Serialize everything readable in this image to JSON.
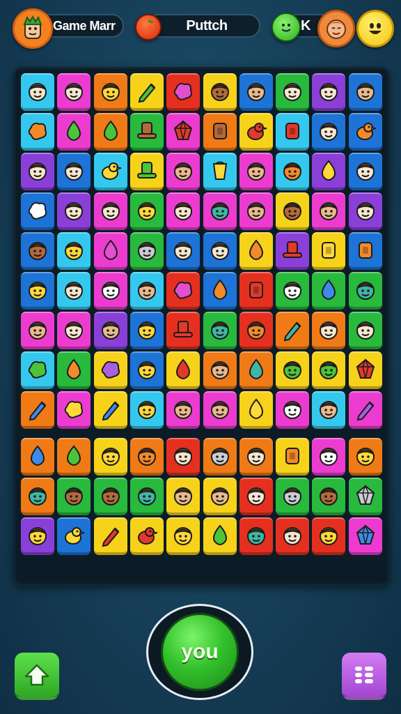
{
  "header": {
    "player_name": "Game Marr",
    "center_label": "Puttch",
    "right_label": "K"
  },
  "play_button_label": "you",
  "colors": {
    "background": "#163f58",
    "play_button": "#34c22c",
    "home_button": "#3fc334",
    "grid_button": "#b95de2"
  },
  "tile_palette": {
    "c": "#35c8ee",
    "m": "#ec3ccf",
    "o": "#f07a15",
    "y": "#f7d21a",
    "r": "#e5301f",
    "b": "#1d73d6",
    "g": "#28b93d",
    "p": "#8b3fd9"
  },
  "board": {
    "columns": 10,
    "rows": [
      [
        [
          "c",
          "face",
          "cream"
        ],
        [
          "m",
          "face",
          "cream"
        ],
        [
          "o",
          "face",
          "yellow"
        ],
        [
          "y",
          "pencil",
          "green"
        ],
        [
          "r",
          "blob",
          "magenta"
        ],
        [
          "y",
          "face",
          "brown"
        ],
        [
          "b",
          "face",
          "tan"
        ],
        [
          "g",
          "face",
          "cream"
        ],
        [
          "p",
          "face",
          "cream"
        ],
        [
          "b",
          "face",
          "tan"
        ]
      ],
      [
        [
          "c",
          "blob",
          "orange"
        ],
        [
          "m",
          "drop",
          "green"
        ],
        [
          "o",
          "drop",
          "green"
        ],
        [
          "g",
          "hat",
          "brown"
        ],
        [
          "m",
          "gem",
          "red"
        ],
        [
          "o",
          "box",
          "brown"
        ],
        [
          "y",
          "bird",
          "red"
        ],
        [
          "c",
          "box",
          "red"
        ],
        [
          "b",
          "face",
          "cream"
        ],
        [
          "b",
          "bird",
          "orange"
        ]
      ],
      [
        [
          "p",
          "face",
          "cream"
        ],
        [
          "b",
          "face",
          "cream"
        ],
        [
          "c",
          "bird",
          "yellow"
        ],
        [
          "y",
          "hat",
          "green"
        ],
        [
          "m",
          "face",
          "tan"
        ],
        [
          "c",
          "cup",
          "yellow"
        ],
        [
          "m",
          "face",
          "tan"
        ],
        [
          "c",
          "face",
          "orange"
        ],
        [
          "p",
          "drop",
          "yellow"
        ],
        [
          "b",
          "face",
          "cream"
        ]
      ],
      [
        [
          "b",
          "blob",
          "white"
        ],
        [
          "p",
          "face",
          "cream"
        ],
        [
          "m",
          "face",
          "cream"
        ],
        [
          "g",
          "face",
          "yellow"
        ],
        [
          "m",
          "face",
          "cream"
        ],
        [
          "m",
          "face",
          "teal"
        ],
        [
          "m",
          "face",
          "tan"
        ],
        [
          "y",
          "face",
          "brown"
        ],
        [
          "m",
          "face",
          "tan"
        ],
        [
          "p",
          "face",
          "cream"
        ]
      ],
      [
        [
          "b",
          "face",
          "brown"
        ],
        [
          "c",
          "face",
          "yellow"
        ],
        [
          "m",
          "drop",
          "magenta"
        ],
        [
          "g",
          "face",
          "grey"
        ],
        [
          "b",
          "face",
          "cream"
        ],
        [
          "b",
          "face",
          "cream"
        ],
        [
          "y",
          "drop",
          "orange"
        ],
        [
          "p",
          "hat",
          "red"
        ],
        [
          "y",
          "box",
          "yellow"
        ],
        [
          "b",
          "box",
          "orange"
        ]
      ],
      [
        [
          "b",
          "face",
          "yellow"
        ],
        [
          "c",
          "face",
          "cream"
        ],
        [
          "m",
          "face",
          "white"
        ],
        [
          "c",
          "face",
          "tan"
        ],
        [
          "r",
          "blob",
          "magenta"
        ],
        [
          "b",
          "drop",
          "orange"
        ],
        [
          "r",
          "box",
          "red"
        ],
        [
          "g",
          "face",
          "white"
        ],
        [
          "g",
          "drop",
          "blue"
        ],
        [
          "g",
          "face",
          "teal"
        ]
      ],
      [
        [
          "m",
          "face",
          "tan"
        ],
        [
          "m",
          "face",
          "cream"
        ],
        [
          "p",
          "face",
          "tan"
        ],
        [
          "b",
          "face",
          "yellow"
        ],
        [
          "r",
          "hat",
          "red"
        ],
        [
          "g",
          "face",
          "teal"
        ],
        [
          "r",
          "face",
          "orange"
        ],
        [
          "o",
          "pencil",
          "teal"
        ],
        [
          "o",
          "face",
          "cream"
        ],
        [
          "g",
          "face",
          "cream"
        ]
      ],
      [
        [
          "c",
          "blob",
          "green"
        ],
        [
          "g",
          "drop",
          "orange"
        ],
        [
          "y",
          "blob",
          "purple"
        ],
        [
          "b",
          "face",
          "yellow"
        ],
        [
          "y",
          "drop",
          "red"
        ],
        [
          "o",
          "face",
          "tan"
        ],
        [
          "o",
          "drop",
          "teal"
        ],
        [
          "y",
          "face",
          "green"
        ],
        [
          "y",
          "face",
          "green"
        ],
        [
          "y",
          "gem",
          "red"
        ]
      ],
      [
        [
          "o",
          "pencil",
          "blue"
        ],
        [
          "m",
          "blob",
          "yellow"
        ],
        [
          "y",
          "pencil",
          "blue"
        ],
        [
          "c",
          "face",
          "yellow"
        ],
        [
          "m",
          "face",
          "tan"
        ],
        [
          "m",
          "face",
          "tan"
        ],
        [
          "y",
          "drop",
          "yellow"
        ],
        [
          "m",
          "face",
          "white"
        ],
        [
          "c",
          "face",
          "tan"
        ],
        [
          "m",
          "pencil",
          "purple"
        ]
      ],
      [
        [
          "o",
          "drop",
          "blue"
        ],
        [
          "o",
          "drop",
          "green"
        ],
        [
          "y",
          "face",
          "yellow"
        ],
        [
          "o",
          "face",
          "orange"
        ],
        [
          "r",
          "face",
          "cream"
        ],
        [
          "o",
          "face",
          "grey"
        ],
        [
          "o",
          "face",
          "cream"
        ],
        [
          "y",
          "box",
          "orange"
        ],
        [
          "m",
          "face",
          "white"
        ],
        [
          "o",
          "face",
          "yellow"
        ]
      ],
      [
        [
          "o",
          "face",
          "teal"
        ],
        [
          "g",
          "face",
          "brown"
        ],
        [
          "g",
          "face",
          "brown"
        ],
        [
          "g",
          "face",
          "teal"
        ],
        [
          "y",
          "face",
          "tan"
        ],
        [
          "y",
          "face",
          "tan"
        ],
        [
          "r",
          "face",
          "cream"
        ],
        [
          "g",
          "face",
          "grey"
        ],
        [
          "g",
          "face",
          "brown"
        ],
        [
          "g",
          "gem",
          "grey"
        ]
      ],
      [
        [
          "p",
          "face",
          "yellow"
        ],
        [
          "b",
          "bird",
          "yellow"
        ],
        [
          "y",
          "pencil",
          "red"
        ],
        [
          "y",
          "bird",
          "red"
        ],
        [
          "y",
          "face",
          "yellow"
        ],
        [
          "y",
          "drop",
          "green"
        ],
        [
          "r",
          "face",
          "teal"
        ],
        [
          "r",
          "face",
          "cream"
        ],
        [
          "r",
          "face",
          "yellow"
        ],
        [
          "m",
          "gem",
          "blue"
        ]
      ]
    ]
  }
}
